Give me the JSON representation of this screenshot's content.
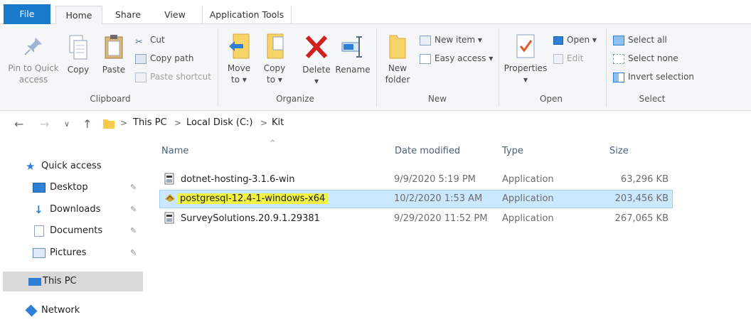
{
  "tabs": {
    "file": "File",
    "home": "Home",
    "share": "Share",
    "view": "View",
    "app_tools": "Application Tools"
  },
  "ribbon": {
    "clipboard": {
      "pin_line1": "Pin to Quick",
      "pin_line2": "access",
      "copy": "Copy",
      "paste": "Paste",
      "cut": "Cut",
      "copy_path": "Copy path",
      "paste_shortcut": "Paste shortcut",
      "label": "Clipboard"
    },
    "organize": {
      "move_line1": "Move",
      "move_line2": "to ▾",
      "copy_line1": "Copy",
      "copy_line2": "to ▾",
      "delete": "Delete",
      "delete_arrow": "▾",
      "rename": "Rename",
      "label": "Organize"
    },
    "new": {
      "folder_line1": "New",
      "folder_line2": "folder",
      "new_item": "New item ▾",
      "easy_access": "Easy access ▾",
      "label": "New"
    },
    "open": {
      "properties": "Properties",
      "properties_arrow": "▾",
      "open": "Open ▾",
      "edit": "Edit",
      "label": "Open"
    },
    "select": {
      "select_all": "Select all",
      "select_none": "Select none",
      "invert": "Invert selection",
      "label": "Select"
    }
  },
  "address": {
    "back": "←",
    "forward": "→",
    "recent": "∨",
    "up": "↑",
    "crumbs": [
      "This PC",
      "Local Disk (C:)",
      "Kit"
    ],
    "sep": ">"
  },
  "nav": {
    "quick_access": "Quick access",
    "desktop": "Desktop",
    "downloads": "Downloads",
    "documents": "Documents",
    "pictures": "Pictures",
    "this_pc": "This PC",
    "network": "Network",
    "pin_glyph": "★"
  },
  "files": {
    "headers": {
      "name": "Name",
      "date": "Date modified",
      "type": "Type",
      "size": "Size",
      "sort_glyph": "^"
    },
    "rows": [
      {
        "name": "dotnet-hosting-3.1.6-win",
        "date": "9/9/2020 5:19 PM",
        "type": "Application",
        "size": "63,296 KB"
      },
      {
        "name": "postgresql-12.4-1-windows-x64",
        "date": "10/2/2020 1:53 AM",
        "type": "Application",
        "size": "203,456 KB"
      },
      {
        "name": "SurveySolutions.20.9.1.29381",
        "date": "9/29/2020 11:52 PM",
        "type": "Application",
        "size": "267,065 KB"
      }
    ]
  },
  "colors": {
    "accent": "#1979ca",
    "selection": "#cce8ff",
    "highlight": "#f2f244",
    "delete_red": "#d02020"
  }
}
